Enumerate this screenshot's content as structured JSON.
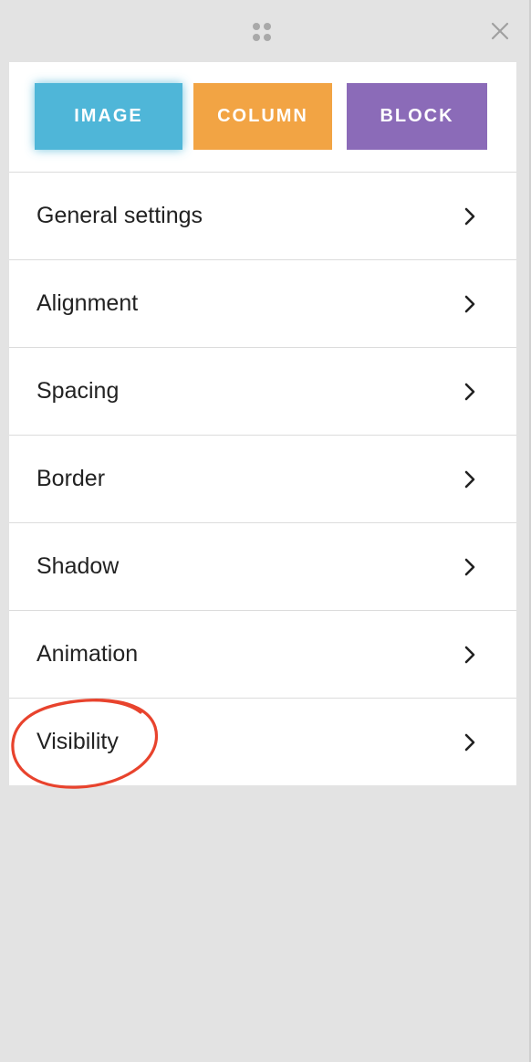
{
  "tabs": [
    {
      "label": "IMAGE",
      "color": "#4fb6d8"
    },
    {
      "label": "COLUMN",
      "color": "#f2a444"
    },
    {
      "label": "BLOCK",
      "color": "#8b6bb8"
    }
  ],
  "menu": [
    {
      "label": "General settings"
    },
    {
      "label": "Alignment"
    },
    {
      "label": "Spacing"
    },
    {
      "label": "Border"
    },
    {
      "label": "Shadow"
    },
    {
      "label": "Animation"
    },
    {
      "label": "Visibility"
    }
  ],
  "icons": {
    "drag": "drag-handle-icon",
    "close": "close-icon",
    "arrow": "chevron-right-icon"
  },
  "annotation": {
    "color": "#e8432d",
    "target": "Visibility"
  }
}
